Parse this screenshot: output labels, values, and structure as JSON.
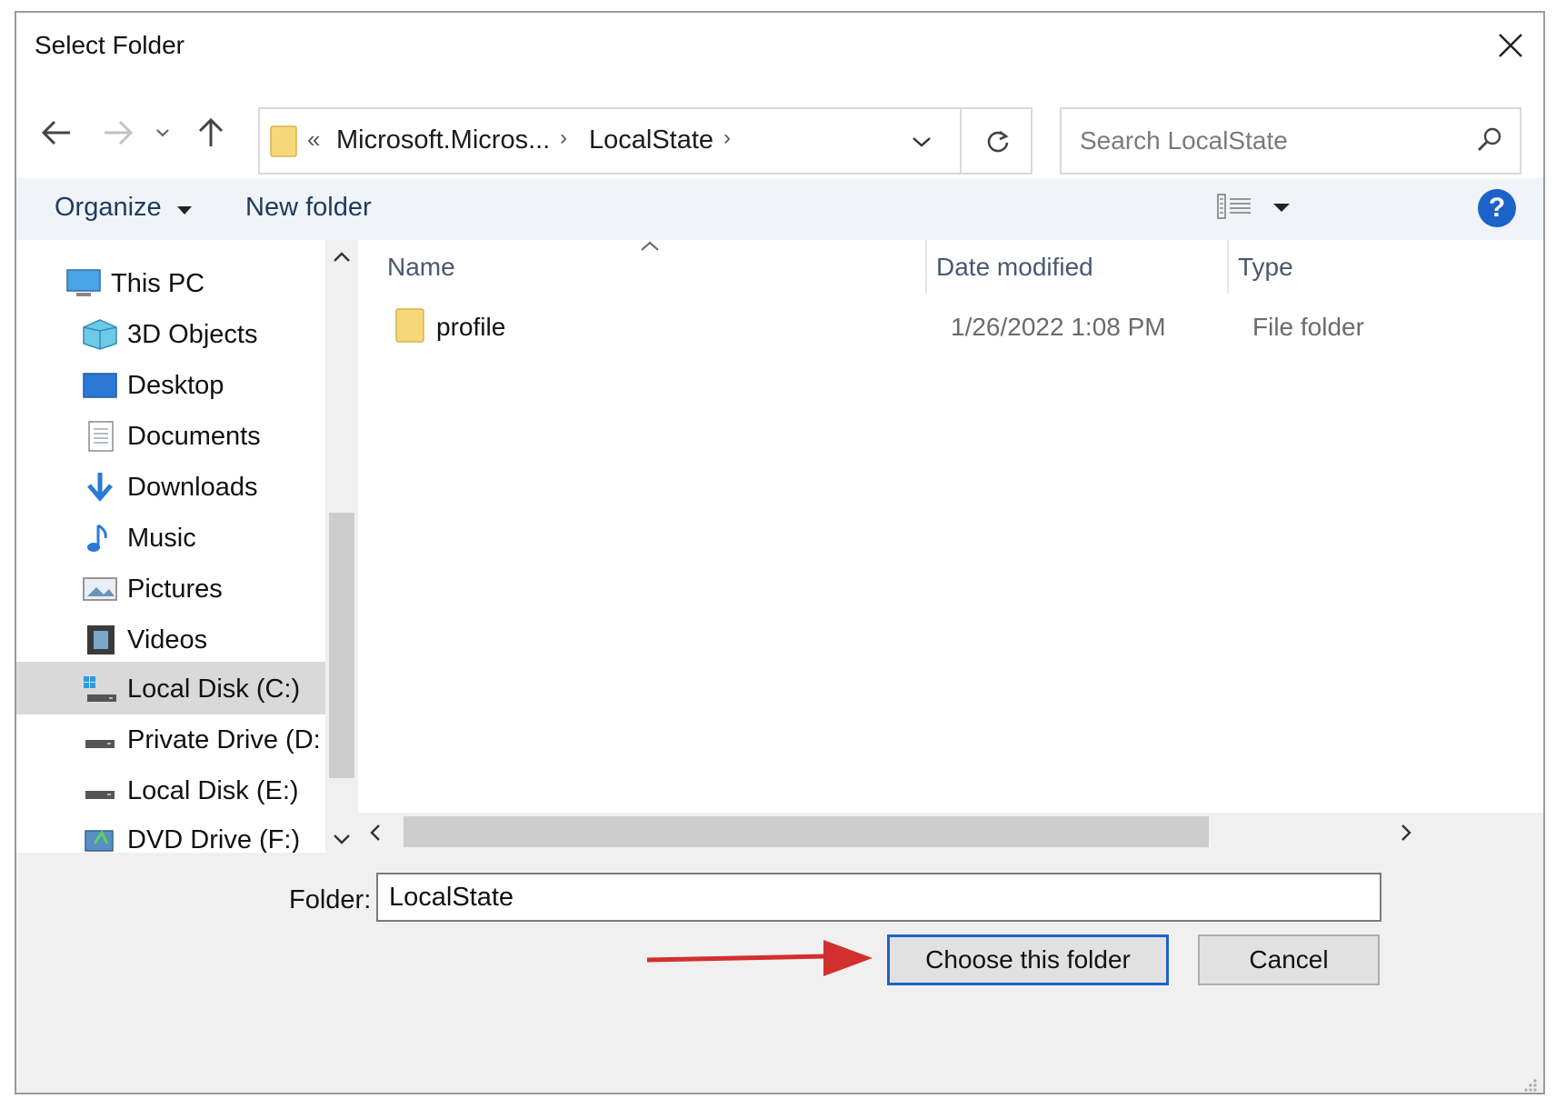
{
  "dialog": {
    "title": "Select Folder"
  },
  "address_bar": {
    "prefix": "«",
    "crumbs": [
      "Microsoft.Micros...",
      "LocalState"
    ]
  },
  "search": {
    "placeholder": "Search LocalState"
  },
  "command_bar": {
    "organize": "Organize",
    "new_folder": "New folder"
  },
  "nav_pane": {
    "items": [
      {
        "label": "This PC",
        "icon": "pc-icon"
      },
      {
        "label": "3D Objects",
        "icon": "cube-icon"
      },
      {
        "label": "Desktop",
        "icon": "desktop-icon"
      },
      {
        "label": "Documents",
        "icon": "documents-icon"
      },
      {
        "label": "Downloads",
        "icon": "download-icon"
      },
      {
        "label": "Music",
        "icon": "music-icon"
      },
      {
        "label": "Pictures",
        "icon": "pictures-icon"
      },
      {
        "label": "Videos",
        "icon": "videos-icon"
      },
      {
        "label": "Local Disk (C:)",
        "icon": "windows-drive-icon",
        "selected": true
      },
      {
        "label": "Private Drive (D:)",
        "icon": "drive-icon"
      },
      {
        "label": "Local Disk (E:)",
        "icon": "drive-icon"
      },
      {
        "label": "DVD Drive (F:) ES",
        "icon": "dvd-drive-icon"
      }
    ]
  },
  "file_list": {
    "columns": [
      "Name",
      "Date modified",
      "Type"
    ],
    "rows": [
      {
        "name": "profile",
        "date_modified": "1/26/2022 1:08 PM",
        "type": "File folder"
      }
    ]
  },
  "footer": {
    "folder_label": "Folder:",
    "folder_value": "LocalState",
    "choose_button": "Choose this folder",
    "cancel_button": "Cancel"
  },
  "colors": {
    "accent": "#1c63c8",
    "annotation_arrow": "#d32f2f",
    "selected_bg": "#d9d9d9"
  }
}
